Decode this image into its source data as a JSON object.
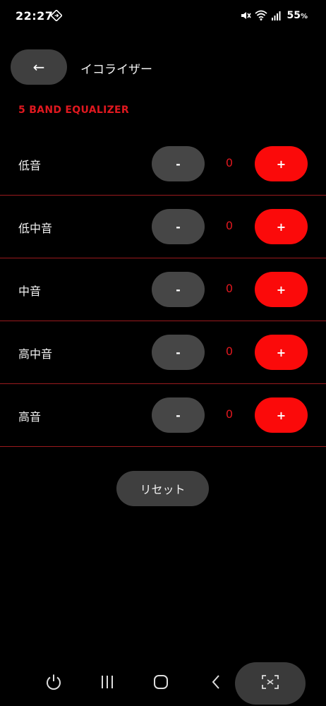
{
  "status_bar": {
    "time": "22:27",
    "battery_percent": "55",
    "battery_unit": "%",
    "icons": [
      "sync-icon",
      "mute-icon",
      "wifi-icon",
      "signal-icon"
    ]
  },
  "header": {
    "back_symbol": "←",
    "title": "イコライザー"
  },
  "section_title": "5 BAND EQUALIZER",
  "bands": [
    {
      "label": "低音",
      "value": "0",
      "minus_label": "-",
      "plus_label": "+"
    },
    {
      "label": "低中音",
      "value": "0",
      "minus_label": "-",
      "plus_label": "+"
    },
    {
      "label": "中音",
      "value": "0",
      "minus_label": "-",
      "plus_label": "+"
    },
    {
      "label": "高中音",
      "value": "0",
      "minus_label": "-",
      "plus_label": "+"
    },
    {
      "label": "高音",
      "value": "0",
      "minus_label": "-",
      "plus_label": "+"
    }
  ],
  "reset_label": "リセット",
  "nav_bar": {
    "icons": [
      "power-icon",
      "recent-apps-icon",
      "home-icon",
      "back-nav-icon",
      "capture-icon"
    ]
  },
  "colors": {
    "accent_red": "#fb0a0a",
    "section_red": "#e0181f",
    "divider_red": "#9a1a1d",
    "button_gray": "#464646",
    "background": "#000000"
  }
}
